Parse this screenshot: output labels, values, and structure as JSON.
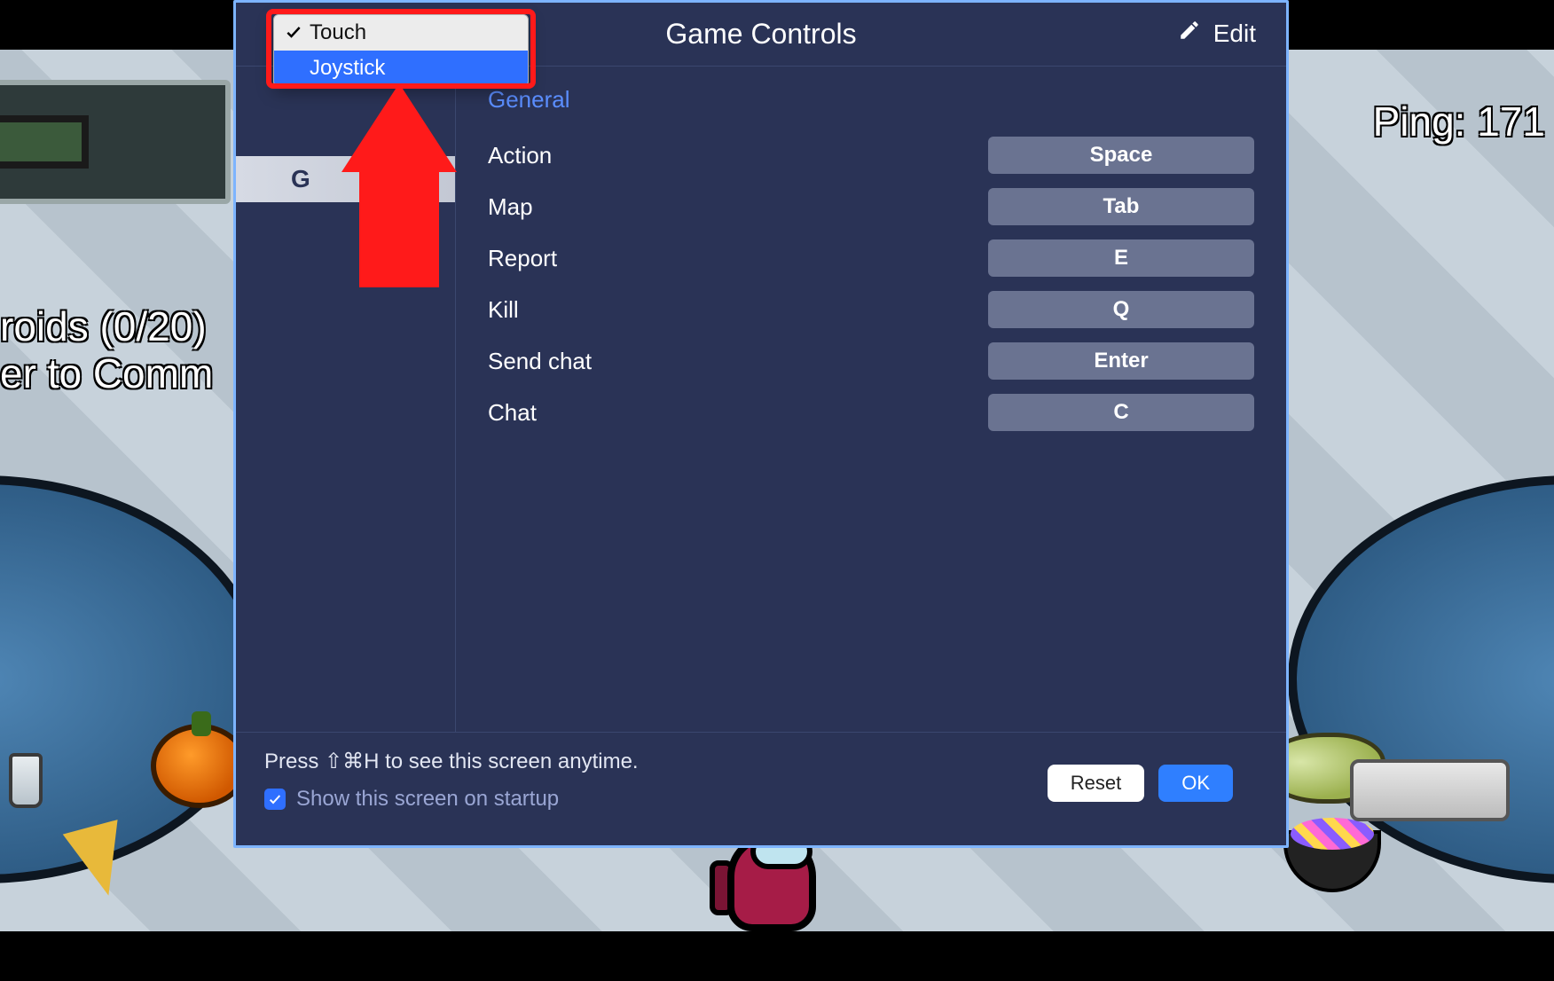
{
  "background": {
    "task_lines": "roids (0/20)\ner to Comm",
    "ping_label": "Ping: 171"
  },
  "dialog": {
    "title": "Game Controls",
    "edit_label": "Edit",
    "sidebar": {
      "selected_label_partial": "G"
    },
    "section_title": "General",
    "bindings": [
      {
        "label": "Action",
        "key": "Space"
      },
      {
        "label": "Map",
        "key": "Tab"
      },
      {
        "label": "Report",
        "key": "E"
      },
      {
        "label": "Kill",
        "key": "Q"
      },
      {
        "label": "Send chat",
        "key": "Enter"
      },
      {
        "label": "Chat",
        "key": "C"
      }
    ],
    "footer": {
      "hint": "Press ⇧⌘H to see this screen anytime.",
      "checkbox_label": "Show this screen on startup",
      "checkbox_checked": true,
      "reset_label": "Reset",
      "ok_label": "OK"
    }
  },
  "dropdown": {
    "items": [
      {
        "label": "Touch",
        "checked": true,
        "highlighted": false
      },
      {
        "label": "Joystick",
        "checked": false,
        "highlighted": true
      }
    ]
  }
}
